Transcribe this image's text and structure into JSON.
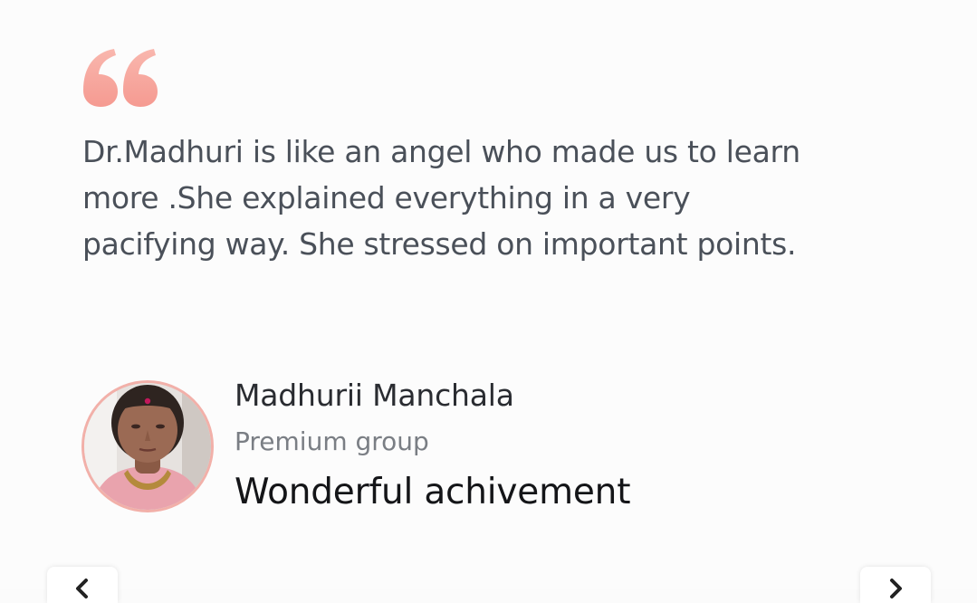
{
  "testimonial": {
    "quote_icon": "quote-open-icon",
    "text": "Dr.Madhuri is like an angel who made us to learn\nmore .She explained everything in a very\npacifying way. She stressed on important points.",
    "author_name": "Madhurii Manchala",
    "author_group": "Premium group",
    "review_title": "Wonderful achivement"
  },
  "carousel": {
    "prev_icon": "chevron-left-icon",
    "next_icon": "chevron-right-icon"
  },
  "colors": {
    "quote_accent": "#f7a8a0",
    "avatar_border": "#f2b0a9",
    "text_body": "#4a5059"
  }
}
